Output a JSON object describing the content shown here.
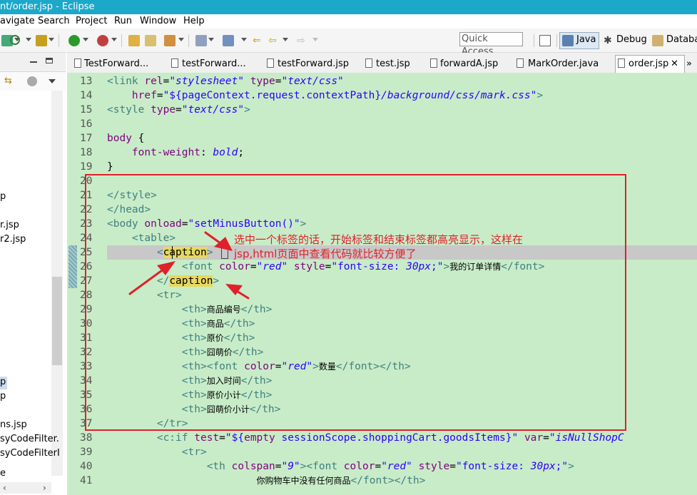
{
  "window": {
    "title": "nt/order.jsp - Eclipse"
  },
  "menu": [
    "avigate",
    "Search",
    "Project",
    "Run",
    "Window",
    "Help"
  ],
  "toolbar": {
    "quick_access": "Quick Access",
    "perspectives": [
      "Java",
      "Debug",
      "Databa"
    ]
  },
  "left_panel": {
    "items": [
      "p",
      "r.jsp",
      "r2.jsp",
      "p",
      "p",
      "ns.jsp",
      "syCodeFilter.",
      "syCodeFilterI",
      "e"
    ]
  },
  "tabs": [
    "TestForward...",
    "testForward...",
    "testForward.jsp",
    "test.jsp",
    "forwardA.jsp",
    "MarkOrder.java",
    "order.jsp",
    "»"
  ],
  "editor": {
    "lines": [
      {
        "n": "13",
        "parts": [
          [
            "tag",
            "<"
          ],
          [
            "el",
            "link "
          ],
          [
            "attr",
            "rel"
          ],
          [
            "",
            "="
          ],
          [
            "str",
            "\"stylesheet\""
          ],
          [
            "",
            ""
          ],
          [
            "attr",
            " type"
          ],
          [
            "",
            "="
          ],
          [
            "str",
            "\"text/css\""
          ]
        ]
      },
      {
        "n": "14",
        "parts": [
          [
            "",
            "    "
          ],
          [
            "attr",
            "href"
          ],
          [
            "",
            "="
          ],
          [
            "strn",
            "\"${pageContext.request.contextPath}"
          ],
          [
            "str",
            "/background/css/mark.css"
          ],
          [
            "strn",
            "\""
          ],
          [
            "tag",
            ">"
          ]
        ]
      },
      {
        "n": "15",
        "parts": [
          [
            "tag",
            "<"
          ],
          [
            "el",
            "style "
          ],
          [
            "attr",
            "type"
          ],
          [
            "",
            "="
          ],
          [
            "str",
            "\"text/css\""
          ],
          [
            "tag",
            ">"
          ]
        ]
      },
      {
        "n": "16",
        "parts": []
      },
      {
        "n": "17",
        "parts": [
          [
            "attr",
            "body "
          ],
          [
            "",
            "{"
          ]
        ]
      },
      {
        "n": "18",
        "parts": [
          [
            "",
            "    "
          ],
          [
            "attr",
            "font-weight"
          ],
          [
            "",
            ": "
          ],
          [
            "str",
            "bold"
          ],
          [
            "",
            ";"
          ]
        ]
      },
      {
        "n": "19",
        "parts": [
          [
            "",
            "}"
          ]
        ]
      },
      {
        "n": "20",
        "parts": []
      },
      {
        "n": "21",
        "parts": [
          [
            "tag",
            "</"
          ],
          [
            "el",
            "style"
          ],
          [
            "tag",
            ">"
          ]
        ]
      },
      {
        "n": "22",
        "parts": [
          [
            "tag",
            "</"
          ],
          [
            "el",
            "head"
          ],
          [
            "tag",
            ">"
          ]
        ]
      },
      {
        "n": "23",
        "parts": [
          [
            "tag",
            "<"
          ],
          [
            "el",
            "body "
          ],
          [
            "attr",
            "onload"
          ],
          [
            "",
            "="
          ],
          [
            "strn",
            "\"setMinusButton()\""
          ],
          [
            "tag",
            ">"
          ]
        ]
      },
      {
        "n": "24",
        "parts": [
          [
            "",
            "    "
          ],
          [
            "tag",
            "<"
          ],
          [
            "el",
            "table"
          ],
          [
            "tag",
            ">"
          ]
        ]
      },
      {
        "n": "25",
        "parts": [
          [
            "",
            "        "
          ],
          [
            "tag",
            "<"
          ],
          [
            "mark",
            "caption"
          ],
          [
            "tag",
            ">"
          ]
        ]
      },
      {
        "n": "26",
        "parts": [
          [
            "",
            "            "
          ],
          [
            "tag",
            "<"
          ],
          [
            "el",
            "font "
          ],
          [
            "attr",
            "color"
          ],
          [
            "",
            "="
          ],
          [
            "str",
            "\"red\""
          ],
          [
            "attr",
            " style"
          ],
          [
            "",
            "="
          ],
          [
            "strn",
            "\"font-size: "
          ],
          [
            "str",
            "30px"
          ],
          [
            "strn",
            ";\""
          ],
          [
            "tag",
            ">"
          ],
          [
            "cjk",
            "我的订单详情"
          ],
          [
            "tag",
            "</"
          ],
          [
            "el",
            "font"
          ],
          [
            "tag",
            ">"
          ]
        ]
      },
      {
        "n": "27",
        "parts": [
          [
            "",
            "        "
          ],
          [
            "tag",
            "</"
          ],
          [
            "mark",
            "caption"
          ],
          [
            "tag",
            ">"
          ]
        ]
      },
      {
        "n": "28",
        "parts": [
          [
            "",
            "        "
          ],
          [
            "tag",
            "<"
          ],
          [
            "el",
            "tr"
          ],
          [
            "tag",
            ">"
          ]
        ]
      },
      {
        "n": "29",
        "parts": [
          [
            "",
            "            "
          ],
          [
            "tag",
            "<"
          ],
          [
            "el",
            "th"
          ],
          [
            "tag",
            ">"
          ],
          [
            "cjk",
            "商品编号"
          ],
          [
            "tag",
            "</"
          ],
          [
            "el",
            "th"
          ],
          [
            "tag",
            ">"
          ]
        ]
      },
      {
        "n": "30",
        "parts": [
          [
            "",
            "            "
          ],
          [
            "tag",
            "<"
          ],
          [
            "el",
            "th"
          ],
          [
            "tag",
            ">"
          ],
          [
            "cjk",
            "商品"
          ],
          [
            "tag",
            "</"
          ],
          [
            "el",
            "th"
          ],
          [
            "tag",
            ">"
          ]
        ]
      },
      {
        "n": "31",
        "parts": [
          [
            "",
            "            "
          ],
          [
            "tag",
            "<"
          ],
          [
            "el",
            "th"
          ],
          [
            "tag",
            ">"
          ],
          [
            "cjk",
            "原价"
          ],
          [
            "tag",
            "</"
          ],
          [
            "el",
            "th"
          ],
          [
            "tag",
            ">"
          ]
        ]
      },
      {
        "n": "32",
        "parts": [
          [
            "",
            "            "
          ],
          [
            "tag",
            "<"
          ],
          [
            "el",
            "th"
          ],
          [
            "tag",
            ">"
          ],
          [
            "cjk",
            "囧萌价"
          ],
          [
            "tag",
            "</"
          ],
          [
            "el",
            "th"
          ],
          [
            "tag",
            ">"
          ]
        ]
      },
      {
        "n": "33",
        "parts": [
          [
            "",
            "            "
          ],
          [
            "tag",
            "<"
          ],
          [
            "el",
            "th"
          ],
          [
            "tag",
            ">"
          ],
          [
            "tag",
            "<"
          ],
          [
            "el",
            "font "
          ],
          [
            "attr",
            "color"
          ],
          [
            "",
            "="
          ],
          [
            "str",
            "\"red\""
          ],
          [
            "tag",
            ">"
          ],
          [
            "cjk",
            "数量"
          ],
          [
            "tag",
            "</"
          ],
          [
            "el",
            "font"
          ],
          [
            "tag",
            "></"
          ],
          [
            "el",
            "th"
          ],
          [
            "tag",
            ">"
          ]
        ]
      },
      {
        "n": "34",
        "parts": [
          [
            "",
            "            "
          ],
          [
            "tag",
            "<"
          ],
          [
            "el",
            "th"
          ],
          [
            "tag",
            ">"
          ],
          [
            "cjk",
            "加入时间"
          ],
          [
            "tag",
            "</"
          ],
          [
            "el",
            "th"
          ],
          [
            "tag",
            ">"
          ]
        ]
      },
      {
        "n": "35",
        "parts": [
          [
            "",
            "            "
          ],
          [
            "tag",
            "<"
          ],
          [
            "el",
            "th"
          ],
          [
            "tag",
            ">"
          ],
          [
            "cjk",
            "原价小计"
          ],
          [
            "tag",
            "</"
          ],
          [
            "el",
            "th"
          ],
          [
            "tag",
            ">"
          ]
        ]
      },
      {
        "n": "36",
        "parts": [
          [
            "",
            "            "
          ],
          [
            "tag",
            "<"
          ],
          [
            "el",
            "th"
          ],
          [
            "tag",
            ">"
          ],
          [
            "cjk",
            "囧萌价小计"
          ],
          [
            "tag",
            "</"
          ],
          [
            "el",
            "th"
          ],
          [
            "tag",
            ">"
          ]
        ]
      },
      {
        "n": "37",
        "parts": [
          [
            "",
            "        "
          ],
          [
            "tag",
            "</"
          ],
          [
            "el",
            "tr"
          ],
          [
            "tag",
            ">"
          ]
        ]
      },
      {
        "n": "38",
        "parts": [
          [
            "",
            "        "
          ],
          [
            "tag",
            "<"
          ],
          [
            "el",
            "c:if "
          ],
          [
            "attr",
            "test"
          ],
          [
            "",
            "="
          ],
          [
            "strn",
            "\"${"
          ],
          [
            "attr",
            "empty"
          ],
          [
            "strn",
            " sessionScope.shoppingCart.goodsItems}\""
          ],
          [
            "attr",
            " var"
          ],
          [
            "",
            "="
          ],
          [
            "str",
            "\"isNullShopC"
          ]
        ]
      },
      {
        "n": "39",
        "parts": [
          [
            "",
            "            "
          ],
          [
            "tag",
            "<"
          ],
          [
            "el",
            "tr"
          ],
          [
            "tag",
            ">"
          ]
        ]
      },
      {
        "n": "40",
        "parts": [
          [
            "",
            "                "
          ],
          [
            "tag",
            "<"
          ],
          [
            "el",
            "th "
          ],
          [
            "attr",
            "colspan"
          ],
          [
            "",
            "="
          ],
          [
            "str",
            "\"9\""
          ],
          [
            "tag",
            ">"
          ],
          [
            "tag",
            "<"
          ],
          [
            "el",
            "font "
          ],
          [
            "attr",
            "color"
          ],
          [
            "",
            "="
          ],
          [
            "str",
            "\"red\""
          ],
          [
            "attr",
            " style"
          ],
          [
            "",
            "="
          ],
          [
            "strn",
            "\"font-size: "
          ],
          [
            "str",
            "30px"
          ],
          [
            "strn",
            ";\""
          ],
          [
            "tag",
            ">"
          ]
        ]
      },
      {
        "n": "41",
        "parts": [
          [
            "",
            "                        "
          ],
          [
            "cjk",
            "你购物车中没有任何商品"
          ],
          [
            "tag",
            "</"
          ],
          [
            "el",
            "font"
          ],
          [
            "tag",
            "></"
          ],
          [
            "el",
            "th"
          ],
          [
            "tag",
            ">"
          ]
        ]
      }
    ]
  },
  "annotation": {
    "text_line1": "选中一个标签的话，开始标签和结束标签都高亮显示，这样在",
    "text_line2": "jsp,html页面中查看代码就比较方便了"
  }
}
